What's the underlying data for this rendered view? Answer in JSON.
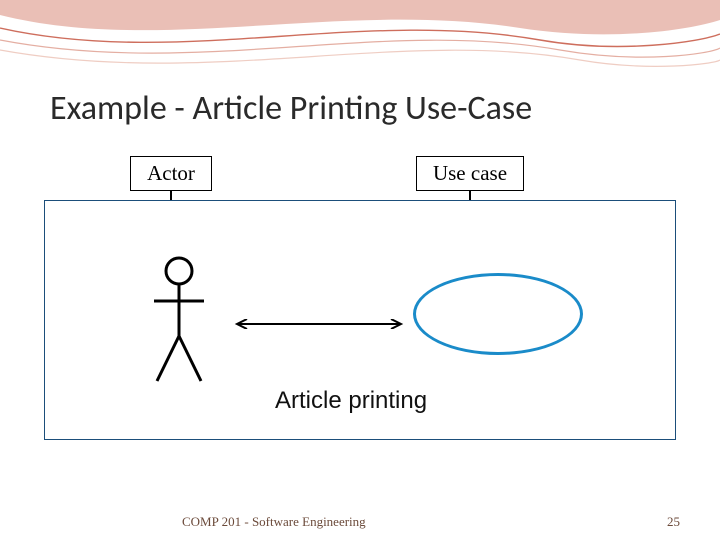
{
  "slide": {
    "title": "Example - Article Printing Use-Case"
  },
  "labels": {
    "actor": "Actor",
    "usecase": "Use case"
  },
  "diagram": {
    "caption": "Article printing"
  },
  "footer": {
    "course": "COMP 201 - Software Engineering",
    "page": "25"
  }
}
